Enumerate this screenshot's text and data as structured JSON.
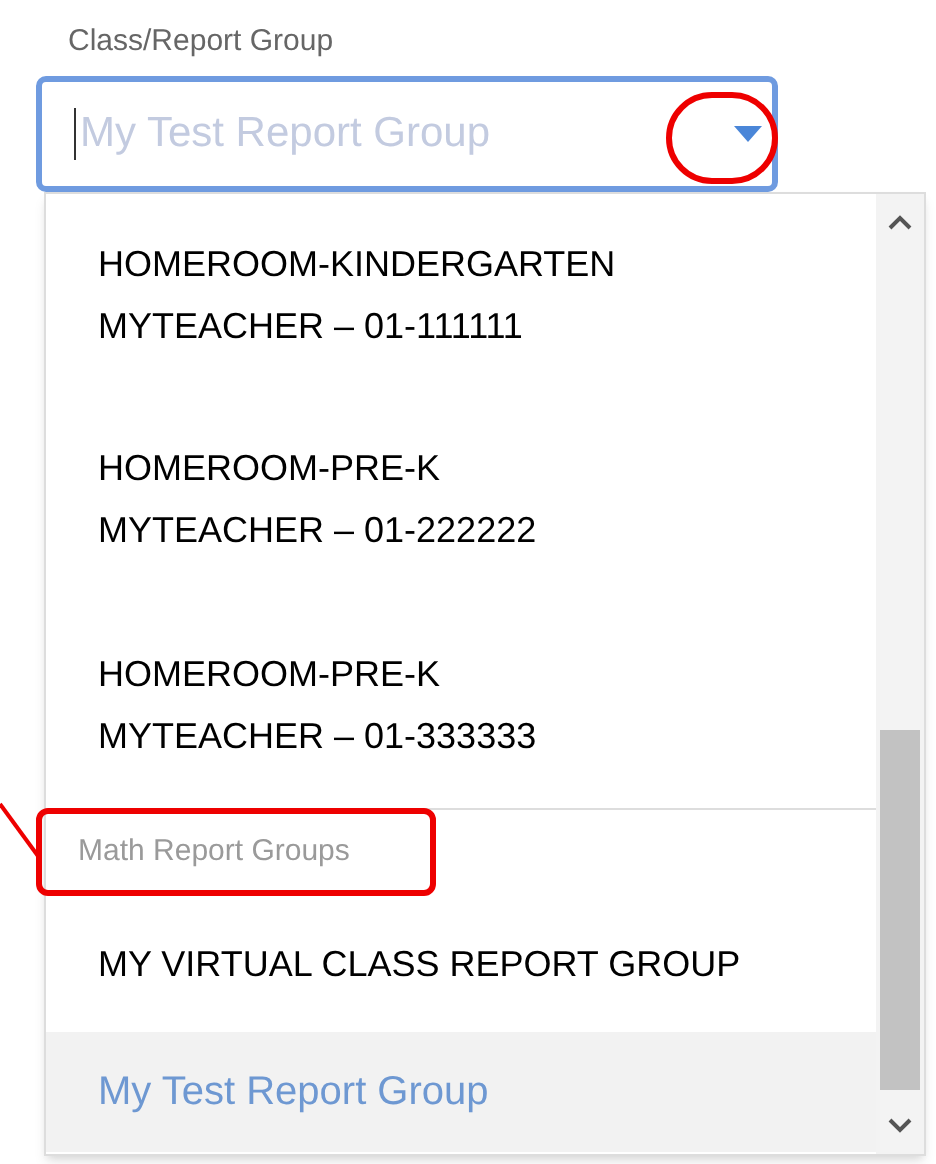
{
  "field": {
    "label": "Class/Report Group",
    "value": "My Test Report Group",
    "expanded": true
  },
  "options": [
    {
      "kind": "option",
      "lines": [
        "HOMEROOM-KINDERGARTEN",
        "MYTEACHER – 01-111111"
      ],
      "selected": false
    },
    {
      "kind": "option",
      "lines": [
        "HOMEROOM-PRE-K",
        "MYTEACHER – 01-222222"
      ],
      "selected": false
    },
    {
      "kind": "option",
      "lines": [
        "HOMEROOM-PRE-K",
        "MYTEACHER – 01-333333"
      ],
      "selected": false
    },
    {
      "kind": "header",
      "lines": [
        "Math Report Groups"
      ]
    },
    {
      "kind": "option",
      "lines": [
        "MY VIRTUAL CLASS REPORT GROUP"
      ],
      "selected": false
    },
    {
      "kind": "option",
      "lines": [
        "My Test Report Group"
      ],
      "selected": true
    }
  ]
}
